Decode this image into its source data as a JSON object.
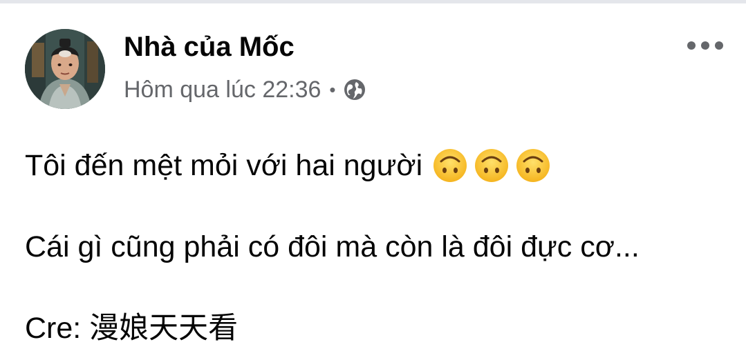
{
  "post": {
    "author": "Nhà của Mốc",
    "timestamp": "Hôm qua lúc 22:36",
    "separator": "•",
    "privacy_icon": "globe-icon",
    "more_icon": "more-options-icon",
    "paragraphs": [
      "Tôi đến mệt mỏi với hai người",
      "Cái gì cũng phải có đôi mà còn là đôi đực cơ...",
      "Cre: 漫娘天天看"
    ],
    "emoji": [
      "upside-down-face-emoji",
      "upside-down-face-emoji",
      "upside-down-face-emoji"
    ]
  },
  "colors": {
    "text_primary": "#050505",
    "text_secondary": "#65676b",
    "emoji_face": "#ffcc33",
    "divider": "#e4e6eb"
  }
}
